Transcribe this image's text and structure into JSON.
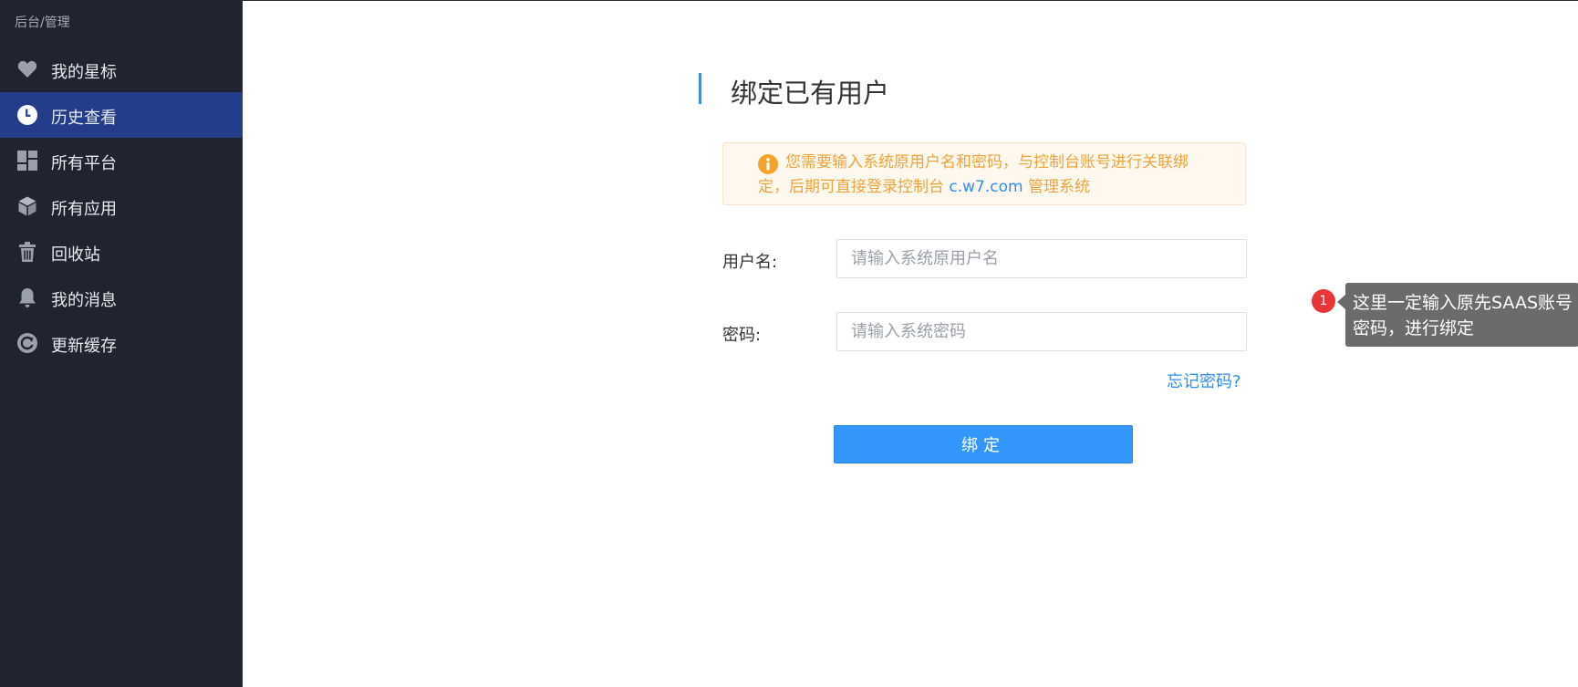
{
  "sidebar": {
    "breadcrumb": "后台/管理",
    "items": [
      {
        "label": "我的星标",
        "icon": "heart-icon",
        "active": false
      },
      {
        "label": "历史查看",
        "icon": "clock-icon",
        "active": true
      },
      {
        "label": "所有平台",
        "icon": "dashboard-icon",
        "active": false
      },
      {
        "label": "所有应用",
        "icon": "cube-icon",
        "active": false
      },
      {
        "label": "回收站",
        "icon": "trash-icon",
        "active": false
      },
      {
        "label": "我的消息",
        "icon": "bell-icon",
        "active": false
      },
      {
        "label": "更新缓存",
        "icon": "refresh-icon",
        "active": false
      }
    ]
  },
  "main": {
    "title": "绑定已有用户",
    "notice": {
      "icon": "info-icon",
      "text_before": "您需要输入系统原用户名和密码，与控制台账号进行关联绑定，后期可直接登录控制台 ",
      "link": "c.w7.com",
      "text_after": " 管理系统"
    },
    "username": {
      "label": "用户名:",
      "placeholder": "请输入系统原用户名",
      "value": ""
    },
    "password": {
      "label": "密码:",
      "placeholder": "请输入系统密码",
      "value": ""
    },
    "forgot_label": "忘记密码?",
    "bind_label": "绑定"
  },
  "annotation": {
    "badge": "1",
    "text": "这里一定输入原先SAAS账号密码，进行绑定"
  },
  "colors": {
    "sidebar_bg": "#1f2430",
    "sidebar_active": "#243d8a",
    "accent": "#3396fb",
    "notice_text": "#f0a33b",
    "link": "#2e8ef0"
  }
}
